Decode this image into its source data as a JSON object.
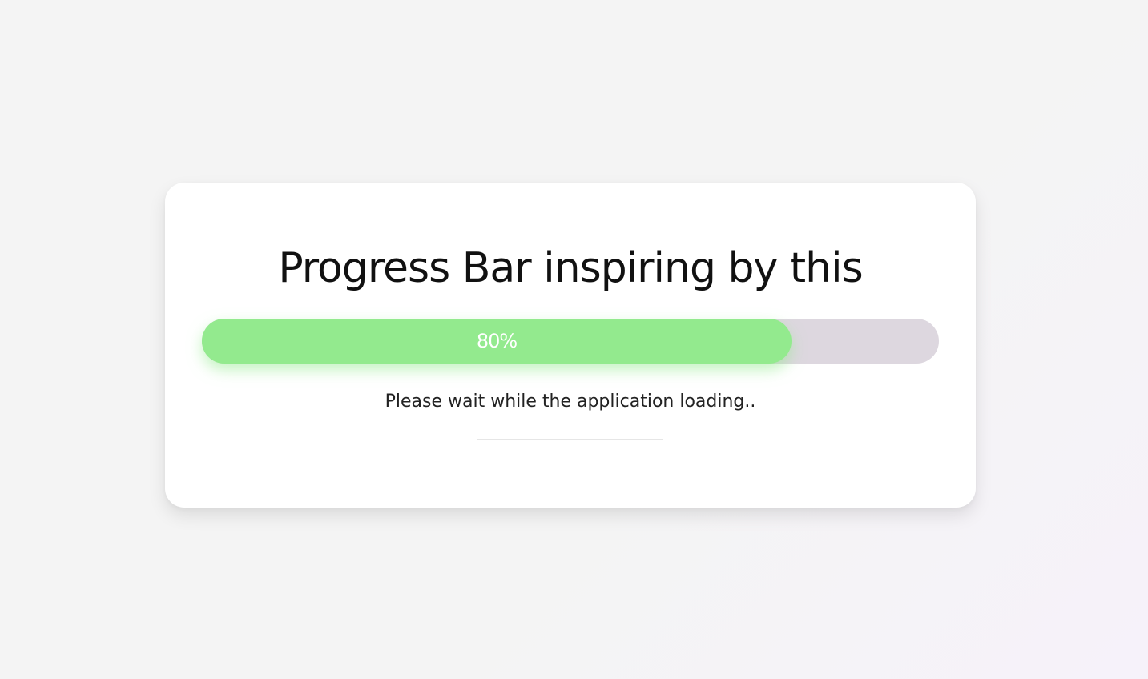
{
  "card": {
    "title": "Progress Bar inspiring by this",
    "progress": {
      "value": 0.8,
      "label": "80%"
    },
    "subtitle": "Please wait while the application loading.."
  },
  "colors": {
    "fill": "#93ea8e",
    "track": "#ddd7df",
    "card": "#ffffff",
    "background": "#f4f4f4"
  }
}
